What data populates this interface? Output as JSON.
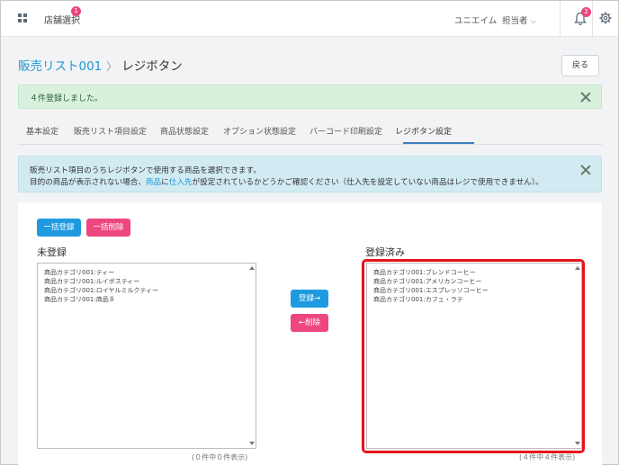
{
  "header": {
    "store_select": "店舗選択",
    "store_badge": "1",
    "company": "ユニエイム",
    "user": "担当者",
    "notification_badge": "2"
  },
  "breadcrumb": {
    "parent": "販売リスト001",
    "current": "レジボタン"
  },
  "back_button": "戻る",
  "success_message": "４件登録しました。",
  "tabs": [
    {
      "label": "基本設定"
    },
    {
      "label": "販売リスト項目設定"
    },
    {
      "label": "商品状態設定"
    },
    {
      "label": "オプション状態設定"
    },
    {
      "label": "バーコード印刷設定"
    },
    {
      "label": "レジボタン設定",
      "active": true
    }
  ],
  "info": {
    "line1": "販売リスト項目のうちレジボタンで使用する商品を選択できます。",
    "line2_a": "目的の商品が表示されない場合、",
    "line2_link1": "商品",
    "line2_b": "に",
    "line2_link2": "仕入先",
    "line2_c": "が設定されているかどうかご確認ください（仕入先を設定していない商品はレジで使用できません）。"
  },
  "bulk_register_button": "一括登録",
  "bulk_delete_button": "一括削除",
  "unregistered": {
    "title": "未登録",
    "items": [
      "商品カテゴリ001:ティー",
      "商品カテゴリ001:ルイボスティー",
      "商品カテゴリ001:ロイヤルミルクティー",
      "商品カテゴリ001:商品８"
    ],
    "count_text": "(０件中０件表示)"
  },
  "registered": {
    "title": "登録済み",
    "items": [
      "商品カテゴリ001:ブレンドコーヒー",
      "商品カテゴリ001:アメリカンコーヒー",
      "商品カテゴリ001:エスプレッソコーヒー",
      "商品カテゴリ001:カフェ・ラテ"
    ],
    "count_text": "(４件中４件表示)"
  },
  "register_button": "登録→",
  "delete_button": "←削除",
  "colors": {
    "primary_blue": "#1e9be0",
    "accent_pink": "#ee4681",
    "link_blue": "#2196d3",
    "success_bg": "#d8f1dd",
    "info_bg": "#d2ebf3",
    "highlight_red": "#e5141c"
  }
}
